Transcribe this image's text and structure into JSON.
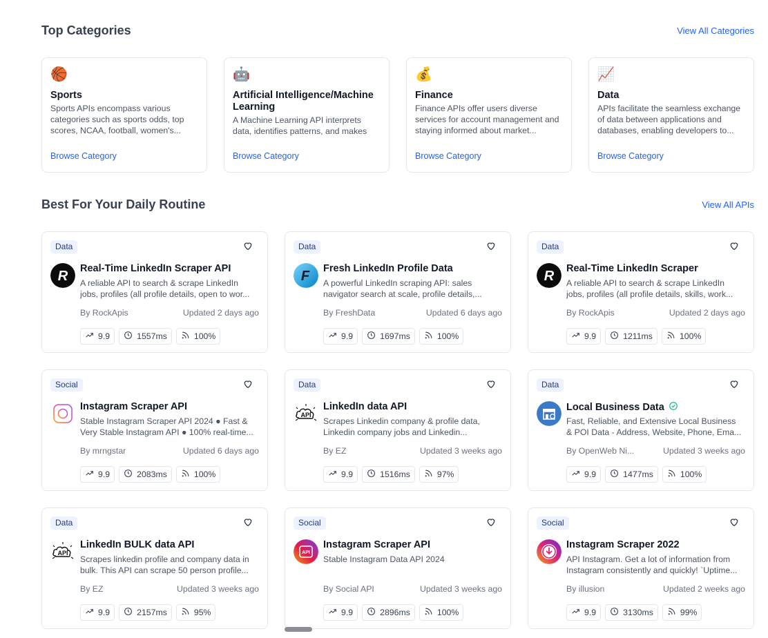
{
  "top_categories": {
    "title": "Top Categories",
    "view_all": "View All Categories",
    "items": [
      {
        "emoji": "🏀",
        "title": "Sports",
        "desc": "Sports APIs encompass various categories such as sports odds, top scores, NCAA, football, women's...",
        "browse": "Browse Category"
      },
      {
        "emoji": "🤖",
        "title": "Artificial Intelligence/Machine Learning",
        "desc": "A Machine Learning API interprets data, identifies patterns, and makes",
        "browse": "Browse Category"
      },
      {
        "emoji": "💰",
        "title": "Finance",
        "desc": "Finance APIs offer users diverse services for account management and staying informed about market...",
        "browse": "Browse Category"
      },
      {
        "emoji": "📈",
        "title": "Data",
        "desc": "APIs facilitate the seamless exchange of data between applications and databases, enabling developers to...",
        "browse": "Browse Category"
      }
    ]
  },
  "daily_routine": {
    "title": "Best For Your Daily Routine",
    "view_all": "View All APIs",
    "cards": [
      {
        "tag": "Data",
        "logo": "rockapis-logo",
        "name": "Real-Time LinkedIn Scraper API",
        "verified": false,
        "desc1": "A reliable API to search & scrape LinkedIn",
        "desc2": "jobs, profiles (all profile details, open to wor...",
        "by": "By RockApis",
        "updated": "Updated 2 days ago",
        "popularity": "9.9",
        "latency": "1557ms",
        "success": "100%"
      },
      {
        "tag": "Data",
        "logo": "freshdata-logo",
        "name": "Fresh LinkedIn Profile Data",
        "verified": false,
        "desc1": "A powerful LinkedIn scraping API: sales",
        "desc2": "navigator search at scale, profile details,...",
        "by": "By FreshData",
        "updated": "Updated 6 days ago",
        "popularity": "9.9",
        "latency": "1697ms",
        "success": "100%"
      },
      {
        "tag": "Data",
        "logo": "rockapis-logo",
        "name": "Real-Time LinkedIn Scraper",
        "verified": false,
        "desc1": "A reliable API to search & scrape LinkedIn",
        "desc2": "jobs, profiles (all profile details, skills, work...",
        "by": "By RockApis",
        "updated": "Updated 2 days ago",
        "popularity": "9.9",
        "latency": "1211ms",
        "success": "100%"
      },
      {
        "tag": "Social",
        "logo": "instagram-outline-logo",
        "name": "Instagram Scraper API",
        "verified": false,
        "desc1": "Stable Instagram Scraper API 2024 ● Fast &",
        "desc2": "Very Stable Instagram API ● 100% real-time...",
        "by": "By mrngstar",
        "updated": "Updated 6 days ago",
        "popularity": "9.9",
        "latency": "2083ms",
        "success": "100%"
      },
      {
        "tag": "Data",
        "logo": "api-cloud-logo",
        "name": "LinkedIn data API",
        "verified": false,
        "desc1": "Scrapes Linkedin company & profile data,",
        "desc2": "Linkedin company jobs and Linkedin...",
        "by": "By EZ",
        "updated": "Updated 3 weeks ago",
        "popularity": "9.9",
        "latency": "1516ms",
        "success": "97%"
      },
      {
        "tag": "Data",
        "logo": "store-logo",
        "name": "Local Business Data",
        "verified": true,
        "desc1": "Fast, Reliable, and Extensive Local Business",
        "desc2": "& POI Data - Address, Website, Phone, Ema...",
        "by": "By OpenWeb Ni...",
        "updated": "Updated 3 weeks ago",
        "popularity": "9.9",
        "latency": "1477ms",
        "success": "100%"
      },
      {
        "tag": "Data",
        "logo": "api-cloud-logo",
        "name": "LinkedIn BULK data API",
        "verified": false,
        "desc1": "Scrapes linkedin profile and company data in",
        "desc2": "bulk. This API can scrape 50 person profile...",
        "by": "By EZ",
        "updated": "Updated 3 weeks ago",
        "popularity": "9.9",
        "latency": "2157ms",
        "success": "95%"
      },
      {
        "tag": "Social",
        "logo": "instagram-api-logo",
        "name": "Instagram Scraper API",
        "verified": false,
        "desc1": "Stable Instagram Data API 2024",
        "desc2": "",
        "by": "By Social API",
        "updated": "Updated 3 weeks ago",
        "popularity": "9.9",
        "latency": "2896ms",
        "success": "100%"
      },
      {
        "tag": "Social",
        "logo": "instagram-download-logo",
        "name": "Instagram Scraper 2022",
        "verified": false,
        "desc1": "API Instagram. Get a lot of information from",
        "desc2": "Instagram consistently and quickly! `Uptime...",
        "by": "By illusion",
        "updated": "Updated 2 weeks ago",
        "popularity": "9.9",
        "latency": "3130ms",
        "success": "99%"
      }
    ]
  },
  "colors": {
    "link": "#2563eb",
    "tag_bg": "#eef2ff",
    "tag_text": "#1e3a8a",
    "border": "#e5e7eb",
    "verified": "#10b981"
  },
  "icons": [
    "heart-icon",
    "trending-up-icon",
    "clock-icon",
    "signal-icon",
    "verified-icon"
  ]
}
